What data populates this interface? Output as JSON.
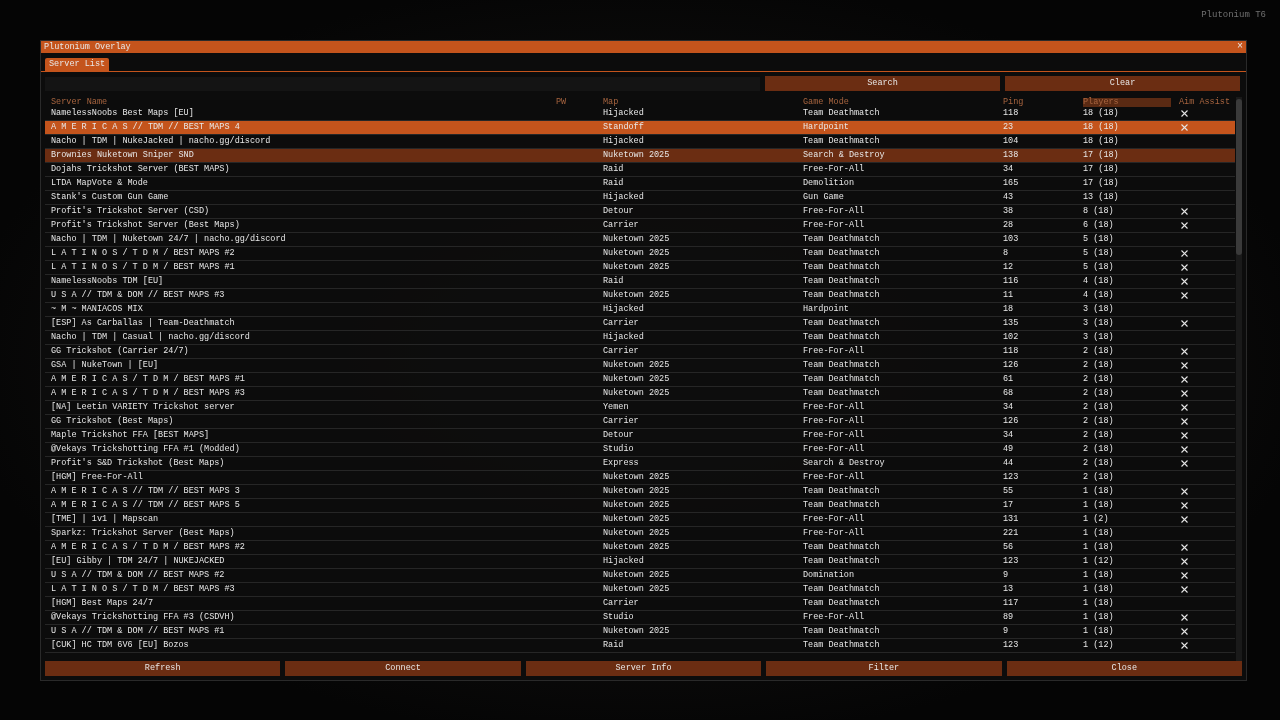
{
  "corner_label": "Plutonium T6",
  "window": {
    "title": "Plutonium Overlay",
    "close": "×"
  },
  "tabs": [
    {
      "label": "Server List",
      "selected": true
    }
  ],
  "search": {
    "button": "Search",
    "clear": "Clear"
  },
  "table": {
    "columns": [
      {
        "label": "Server Name",
        "sorted": false
      },
      {
        "label": "PW",
        "sorted": false
      },
      {
        "label": "Map",
        "sorted": false
      },
      {
        "label": "Game Mode",
        "sorted": false
      },
      {
        "label": "Ping",
        "sorted": false
      },
      {
        "label": "Players",
        "sorted": true
      },
      {
        "label": "Aim Assist",
        "sorted": false
      }
    ],
    "rows": [
      {
        "name": "NamelessNoobs Best Maps [EU]",
        "map": "Hijacked",
        "mode": "Team Deathmatch",
        "ping": "118",
        "players": "18 (18)",
        "aim_assist": true,
        "selected": false,
        "hovered": false
      },
      {
        "name": "A M E R I C A S // TDM // BEST MAPS 4",
        "map": "Standoff",
        "mode": "Hardpoint",
        "ping": "23",
        "players": "18 (18)",
        "aim_assist": true,
        "selected": true,
        "hovered": false
      },
      {
        "name": "Nacho | TDM | NukeJacked | nacho.gg/discord",
        "map": "Hijacked",
        "mode": "Team Deathmatch",
        "ping": "104",
        "players": "18 (18)",
        "aim_assist": false,
        "selected": false,
        "hovered": false
      },
      {
        "name": "Brownies Nuketown Sniper SND",
        "map": "Nuketown 2025",
        "mode": "Search & Destroy",
        "ping": "138",
        "players": "17 (18)",
        "aim_assist": false,
        "selected": false,
        "hovered": true
      },
      {
        "name": "Dojahs Trickshot Server (BEST MAPS)",
        "map": "Raid",
        "mode": "Free-For-All",
        "ping": "34",
        "players": "17 (18)",
        "aim_assist": false,
        "selected": false,
        "hovered": false
      },
      {
        "name": "LTDA MapVote & Mode",
        "map": "Raid",
        "mode": "Demolition",
        "ping": "165",
        "players": "17 (18)",
        "aim_assist": false,
        "selected": false,
        "hovered": false
      },
      {
        "name": "Stank's Custom Gun Game",
        "map": "Hijacked",
        "mode": "Gun Game",
        "ping": "43",
        "players": "13 (18)",
        "aim_assist": false,
        "selected": false,
        "hovered": false
      },
      {
        "name": "Profit's Trickshot Server (CSD)",
        "map": "Detour",
        "mode": "Free-For-All",
        "ping": "38",
        "players": "8 (18)",
        "aim_assist": true,
        "selected": false,
        "hovered": false
      },
      {
        "name": "Profit's Trickshot Server (Best Maps)",
        "map": "Carrier",
        "mode": "Free-For-All",
        "ping": "28",
        "players": "6 (18)",
        "aim_assist": true,
        "selected": false,
        "hovered": false
      },
      {
        "name": "Nacho | TDM | Nuketown 24/7 | nacho.gg/discord",
        "map": "Nuketown 2025",
        "mode": "Team Deathmatch",
        "ping": "103",
        "players": "5 (18)",
        "aim_assist": false,
        "selected": false,
        "hovered": false
      },
      {
        "name": "L A T I N O S / T D M / BEST MAPS #2",
        "map": "Nuketown 2025",
        "mode": "Team Deathmatch",
        "ping": "8",
        "players": "5 (18)",
        "aim_assist": true,
        "selected": false,
        "hovered": false
      },
      {
        "name": "L A T I N O S / T D M / BEST MAPS #1",
        "map": "Nuketown 2025",
        "mode": "Team Deathmatch",
        "ping": "12",
        "players": "5 (18)",
        "aim_assist": true,
        "selected": false,
        "hovered": false
      },
      {
        "name": "NamelessNoobs TDM [EU]",
        "map": "Raid",
        "mode": "Team Deathmatch",
        "ping": "116",
        "players": "4 (18)",
        "aim_assist": true,
        "selected": false,
        "hovered": false
      },
      {
        "name": "U S A // TDM & DOM // BEST MAPS #3",
        "map": "Nuketown 2025",
        "mode": "Team Deathmatch",
        "ping": "11",
        "players": "4 (18)",
        "aim_assist": true,
        "selected": false,
        "hovered": false
      },
      {
        "name": "~ M ~ MANIACOS MIX",
        "map": "Hijacked",
        "mode": "Hardpoint",
        "ping": "18",
        "players": "3 (18)",
        "aim_assist": false,
        "selected": false,
        "hovered": false
      },
      {
        "name": "[ESP] As Carballas | Team-Deathmatch",
        "map": "Carrier",
        "mode": "Team Deathmatch",
        "ping": "135",
        "players": "3 (18)",
        "aim_assist": true,
        "selected": false,
        "hovered": false
      },
      {
        "name": "Nacho | TDM | Casual | nacho.gg/discord",
        "map": "Hijacked",
        "mode": "Team Deathmatch",
        "ping": "102",
        "players": "3 (18)",
        "aim_assist": false,
        "selected": false,
        "hovered": false
      },
      {
        "name": "GG Trickshot (Carrier 24/7)",
        "map": "Carrier",
        "mode": "Free-For-All",
        "ping": "118",
        "players": "2 (18)",
        "aim_assist": true,
        "selected": false,
        "hovered": false
      },
      {
        "name": "GSA | NukeTown | [EU]",
        "map": "Nuketown 2025",
        "mode": "Team Deathmatch",
        "ping": "126",
        "players": "2 (18)",
        "aim_assist": true,
        "selected": false,
        "hovered": false
      },
      {
        "name": "A M E R I C A S / T D M / BEST MAPS #1",
        "map": "Nuketown 2025",
        "mode": "Team Deathmatch",
        "ping": "61",
        "players": "2 (18)",
        "aim_assist": true,
        "selected": false,
        "hovered": false
      },
      {
        "name": "A M E R I C A S / T D M / BEST MAPS #3",
        "map": "Nuketown 2025",
        "mode": "Team Deathmatch",
        "ping": "68",
        "players": "2 (18)",
        "aim_assist": true,
        "selected": false,
        "hovered": false
      },
      {
        "name": "[NA] Leetin VARIETY Trickshot server",
        "map": "Yemen",
        "mode": "Free-For-All",
        "ping": "34",
        "players": "2 (18)",
        "aim_assist": true,
        "selected": false,
        "hovered": false
      },
      {
        "name": "GG Trickshot (Best Maps)",
        "map": "Carrier",
        "mode": "Free-For-All",
        "ping": "126",
        "players": "2 (18)",
        "aim_assist": true,
        "selected": false,
        "hovered": false
      },
      {
        "name": "Maple Trickshot FFA [BEST MAPS]",
        "map": "Detour",
        "mode": "Free-For-All",
        "ping": "34",
        "players": "2 (18)",
        "aim_assist": true,
        "selected": false,
        "hovered": false
      },
      {
        "name": "@Vekays Trickshotting FFA #1 (Modded)",
        "map": "Studio",
        "mode": "Free-For-All",
        "ping": "49",
        "players": "2 (18)",
        "aim_assist": true,
        "selected": false,
        "hovered": false
      },
      {
        "name": "Profit's S&D Trickshot (Best Maps)",
        "map": "Express",
        "mode": "Search & Destroy",
        "ping": "44",
        "players": "2 (18)",
        "aim_assist": true,
        "selected": false,
        "hovered": false
      },
      {
        "name": "[HGM] Free-For-All",
        "map": "Nuketown 2025",
        "mode": "Free-For-All",
        "ping": "123",
        "players": "2 (18)",
        "aim_assist": false,
        "selected": false,
        "hovered": false
      },
      {
        "name": "A M E R I C A S // TDM // BEST MAPS 3",
        "map": "Nuketown 2025",
        "mode": "Team Deathmatch",
        "ping": "55",
        "players": "1 (18)",
        "aim_assist": true,
        "selected": false,
        "hovered": false
      },
      {
        "name": "A M E R I C A S // TDM // BEST MAPS 5",
        "map": "Nuketown 2025",
        "mode": "Team Deathmatch",
        "ping": "17",
        "players": "1 (18)",
        "aim_assist": true,
        "selected": false,
        "hovered": false
      },
      {
        "name": "[TME] | 1v1 | Mapscan",
        "map": "Nuketown 2025",
        "mode": "Free-For-All",
        "ping": "131",
        "players": "1 (2)",
        "aim_assist": true,
        "selected": false,
        "hovered": false
      },
      {
        "name": "Sparkz: Trickshot Server (Best Maps)",
        "map": "Nuketown 2025",
        "mode": "Free-For-All",
        "ping": "221",
        "players": "1 (18)",
        "aim_assist": false,
        "selected": false,
        "hovered": false
      },
      {
        "name": "A M E R I C A S / T D M / BEST MAPS #2",
        "map": "Nuketown 2025",
        "mode": "Team Deathmatch",
        "ping": "56",
        "players": "1 (18)",
        "aim_assist": true,
        "selected": false,
        "hovered": false
      },
      {
        "name": "[EU] Gibby | TDM 24/7 | NUKEJACKED",
        "map": "Hijacked",
        "mode": "Team Deathmatch",
        "ping": "123",
        "players": "1 (12)",
        "aim_assist": true,
        "selected": false,
        "hovered": false
      },
      {
        "name": "U S A // TDM & DOM // BEST MAPS #2",
        "map": "Nuketown 2025",
        "mode": "Domination",
        "ping": "9",
        "players": "1 (18)",
        "aim_assist": true,
        "selected": false,
        "hovered": false
      },
      {
        "name": "L A T I N O S / T D M / BEST MAPS #3",
        "map": "Nuketown 2025",
        "mode": "Team Deathmatch",
        "ping": "13",
        "players": "1 (18)",
        "aim_assist": true,
        "selected": false,
        "hovered": false
      },
      {
        "name": "[HGM] Best Maps 24/7",
        "map": "Carrier",
        "mode": "Team Deathmatch",
        "ping": "117",
        "players": "1 (18)",
        "aim_assist": false,
        "selected": false,
        "hovered": false
      },
      {
        "name": "@Vekays Trickshotting FFA #3 (CSDVH)",
        "map": "Studio",
        "mode": "Free-For-All",
        "ping": "89",
        "players": "1 (18)",
        "aim_assist": true,
        "selected": false,
        "hovered": false
      },
      {
        "name": "U S A // TDM & DOM // BEST MAPS #1",
        "map": "Nuketown 2025",
        "mode": "Team Deathmatch",
        "ping": "9",
        "players": "1 (18)",
        "aim_assist": true,
        "selected": false,
        "hovered": false
      },
      {
        "name": "[CUK] HC TDM 6V6 [EU] Bozos",
        "map": "Raid",
        "mode": "Team Deathmatch",
        "ping": "123",
        "players": "1 (12)",
        "aim_assist": true,
        "selected": false,
        "hovered": false
      }
    ]
  },
  "buttons": [
    "Refresh",
    "Connect",
    "Server Info",
    "Filter",
    "Close"
  ]
}
